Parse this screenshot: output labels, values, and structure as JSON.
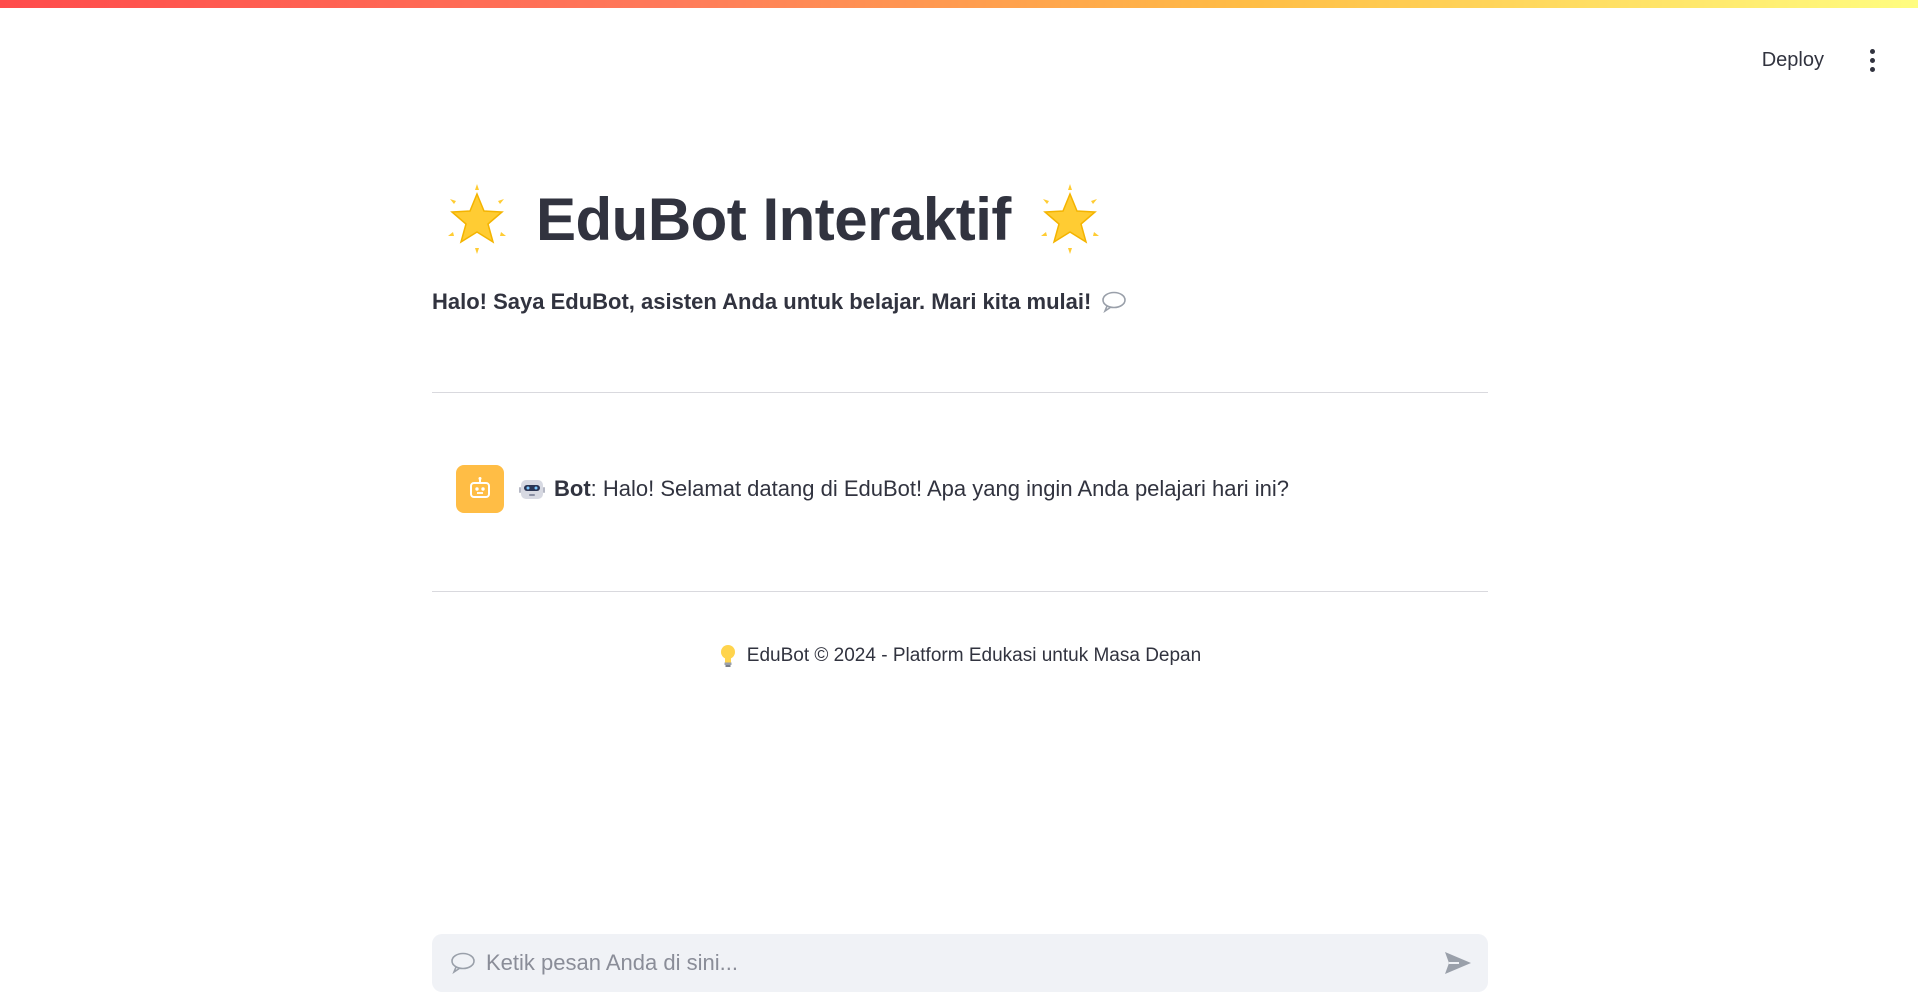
{
  "app": {
    "accent_gradient": [
      "#ff4b4b",
      "#ffbd45",
      "#fffd80"
    ]
  },
  "header": {
    "deploy_label": "Deploy",
    "menu_icon": "kebab-menu-icon"
  },
  "main": {
    "title": "EduBot Interaktif",
    "title_icon": "glowing-star-icon",
    "subtitle": "Halo! Saya EduBot, asisten Anda untuk belajar. Mari kita mulai!",
    "subtitle_icon": "speech-bubble-icon"
  },
  "chat": {
    "messages": [
      {
        "role": "assistant",
        "avatar_icon": "bot-avatar-icon",
        "prefix_icon": "robot-face-icon",
        "sender": "Bot",
        "separator": ": ",
        "text": "Halo! Selamat datang di EduBot! Apa yang ingin Anda pelajari hari ini?"
      }
    ]
  },
  "footer": {
    "icon": "light-bulb-icon",
    "text": "EduBot © 2024 - Platform Edukasi untuk Masa Depan"
  },
  "chat_input": {
    "placeholder": "Ketik pesan Anda di sini...",
    "value": "",
    "icon": "speech-bubble-icon",
    "send_icon": "send-icon"
  }
}
